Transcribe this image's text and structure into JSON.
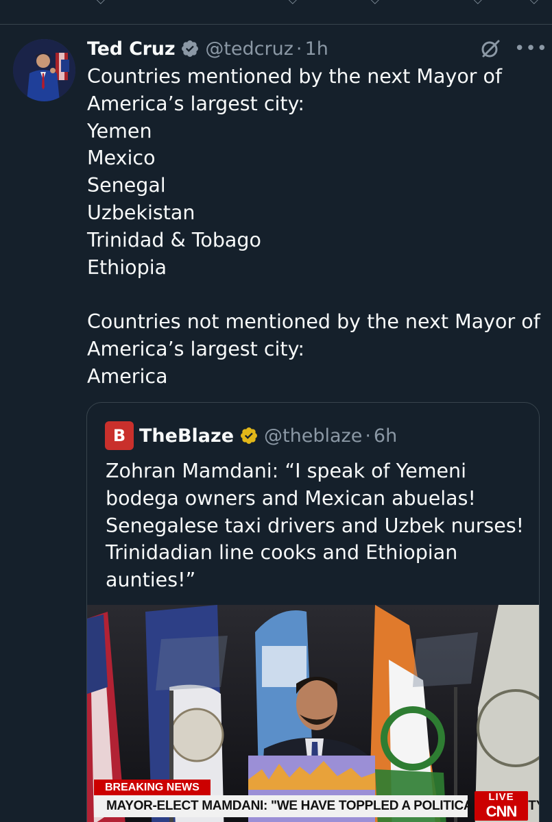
{
  "tweet": {
    "author_name": "Ted Cruz",
    "handle": "@tedcruz",
    "separator": "·",
    "time": "1h",
    "more_icon": "more-horizontal-icon",
    "grok_icon": "grok-icon",
    "lines": [
      "Countries mentioned by the next Mayor of",
      "America’s largest city:",
      "Yemen",
      "Mexico",
      "Senegal",
      "Uzbekistan",
      "Trinidad & Tobago",
      "Ethiopia",
      "",
      "Countries not mentioned by the next Mayor of",
      "America’s largest city:",
      "America"
    ]
  },
  "quote": {
    "author_name": "TheBlaze",
    "logo_text": "B",
    "handle": "@theblaze",
    "separator": "·",
    "time": "6h",
    "lines": [
      "Zohran Mamdani: “I speak of Yemeni",
      "bodega owners and Mexican abuelas!",
      "Senegalese taxi drivers and Uzbek nurses!",
      "Trinidadian line cooks and Ethiopian",
      "aunties!”"
    ],
    "media": {
      "breaking_label": "BREAKING NEWS",
      "headline": "MAYOR-ELECT MAMDANI: \"WE HAVE TOPPLED A POLITICAL DYNASTY\"",
      "live_label": "LIVE",
      "network": "CNN"
    }
  },
  "colors": {
    "background": "#15202b",
    "text": "#f7f9f9",
    "secondary": "#8b98a5",
    "verified_blue": "#1d9bf0",
    "border": "#38444d"
  }
}
